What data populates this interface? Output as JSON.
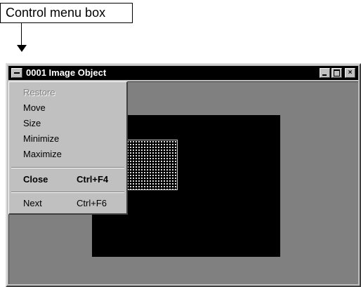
{
  "annotation": {
    "label": "Control menu box"
  },
  "window": {
    "title": "0001 Image Object"
  },
  "control_menu": {
    "items": [
      {
        "label": "Restore",
        "accel": "",
        "enabled": false
      },
      {
        "label": "Move",
        "accel": "",
        "enabled": true
      },
      {
        "label": "Size",
        "accel": "",
        "enabled": true
      },
      {
        "label": "Minimize",
        "accel": "",
        "enabled": true
      },
      {
        "label": "Maximize",
        "accel": "",
        "enabled": true
      },
      {
        "label": "Close",
        "accel": "Ctrl+F4",
        "enabled": true,
        "bold": true
      },
      {
        "label": "Next",
        "accel": "Ctrl+F6",
        "enabled": true
      }
    ]
  },
  "colors": {
    "titlebar": "#000000",
    "face": "#c0c0c0",
    "client_bg": "#808080",
    "image_bg": "#000000"
  }
}
